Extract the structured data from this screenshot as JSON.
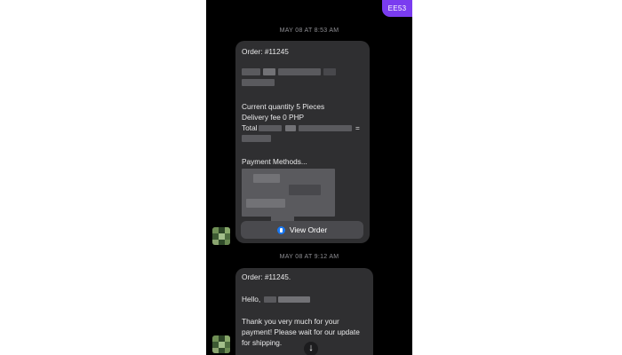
{
  "header": {
    "badge": "EE53"
  },
  "messages": [
    {
      "timestamp": "MAY 08 AT 8:53 AM",
      "order": "Order: #11245",
      "quantity": "Current quantity 5 Pieces",
      "delivery": "Delivery fee 0 PHP",
      "total_label": "Total",
      "total_equals": "=",
      "payment_methods": "Payment Methods...",
      "button_label": "View Order"
    },
    {
      "timestamp": "MAY 08 AT 9:12 AM",
      "order": "Order: #11245.",
      "greeting": "Hello,",
      "line1": "Thank you very much for your",
      "line2": "payment! Please wait for our update",
      "line3": "for shipping."
    }
  ],
  "icons": {
    "view_order": "messenger-icon",
    "scroll": "arrow-down-icon"
  },
  "colors": {
    "badge": "#7a3cf0",
    "bubble": "#2f2f31",
    "background": "#000000",
    "button": "#4a4a4e"
  }
}
